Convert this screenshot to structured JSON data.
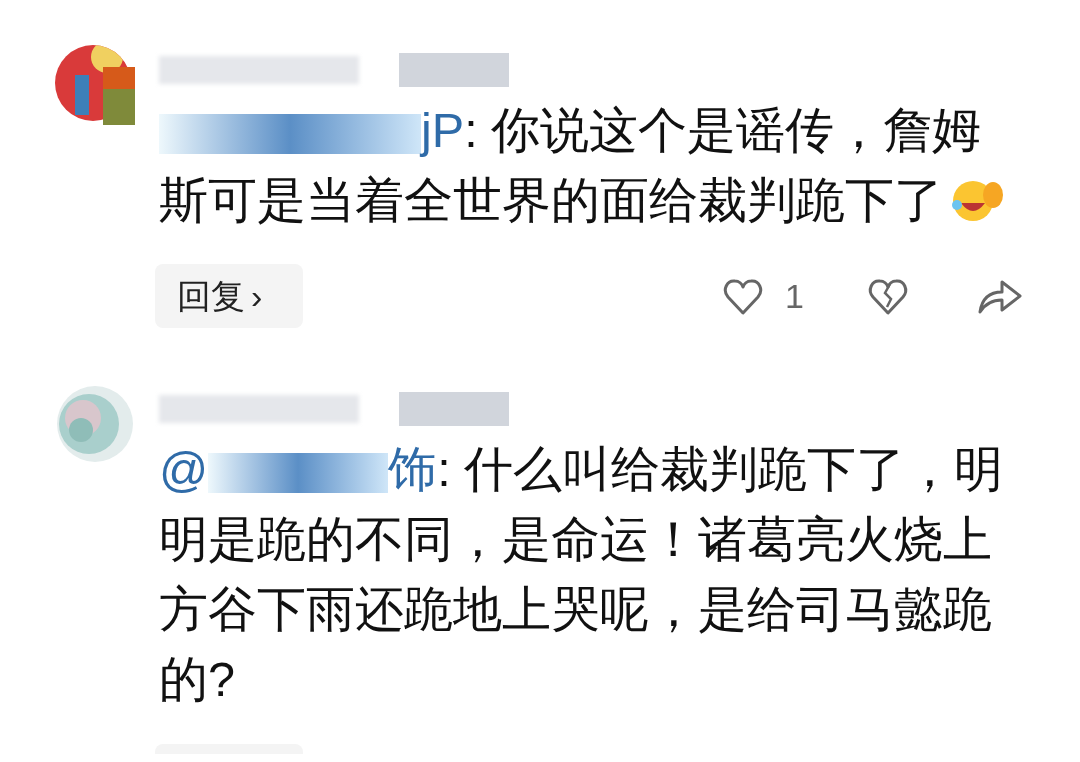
{
  "comments": [
    {
      "avatar": {
        "kind": "red"
      },
      "mention_tail": "jP",
      "body": ": 你说这个是谣传，詹姆斯可是当着全世界的面给裁判跪下了",
      "emoji": true,
      "reply_label": "回复",
      "reply_chevron": "›",
      "likes": "1",
      "actions_visible": true
    },
    {
      "avatar": {
        "kind": "sphere"
      },
      "mention_head": "@",
      "mention_tail": "饰",
      "body": ": 什么叫给裁判跪下了，明明是跪的不同，是命运！诸葛亮火烧上方谷下雨还跪地上哭呢，是给司马懿跪的?",
      "emoji": false,
      "actions_visible": false
    }
  ]
}
